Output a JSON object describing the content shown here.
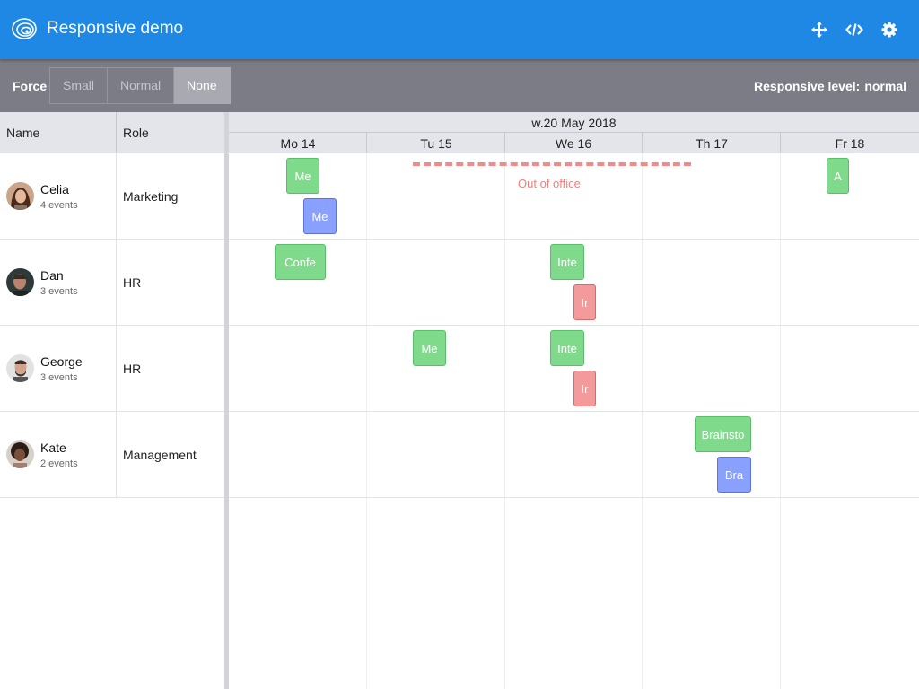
{
  "app": {
    "title": "Responsive demo"
  },
  "header_icons": [
    "move-icon",
    "code-icon",
    "gear-icon"
  ],
  "toolbar": {
    "force_label": "Force",
    "options": [
      "Small",
      "Normal",
      "None"
    ],
    "selected": "None",
    "responsive_label": "Responsive level:",
    "responsive_value": "normal"
  },
  "grid": {
    "columns": {
      "name": "Name",
      "role": "Role"
    },
    "week": "w.20 May 2018",
    "days": [
      "Mo 14",
      "Tu 15",
      "We 16",
      "Th 17",
      "Fr 18"
    ]
  },
  "people": [
    {
      "name": "Celia",
      "events": "4 events",
      "role": "Marketing"
    },
    {
      "name": "Dan",
      "events": "3 events",
      "role": "HR"
    },
    {
      "name": "George",
      "events": "3 events",
      "role": "HR"
    },
    {
      "name": "Kate",
      "events": "2 events",
      "role": "Management"
    }
  ],
  "events": [
    {
      "text": "Me",
      "color": "green"
    },
    {
      "text": "Me",
      "color": "blue"
    },
    {
      "text": "A",
      "color": "green"
    },
    {
      "text": "Confe",
      "color": "green"
    },
    {
      "text": "Inte",
      "color": "green"
    },
    {
      "text": "Ir",
      "color": "red"
    },
    {
      "text": "Me",
      "color": "green"
    },
    {
      "text": "Inte",
      "color": "green"
    },
    {
      "text": "Ir",
      "color": "red"
    },
    {
      "text": "Brainsto",
      "color": "green"
    },
    {
      "text": "Bra",
      "color": "blue"
    }
  ],
  "out_of_office": "Out of office",
  "colors": {
    "header": "#1f88e5",
    "toolbar": "#7b7c85",
    "green": "#7fdb8b",
    "blue": "#8aa0ff",
    "red": "#f59a9a"
  }
}
